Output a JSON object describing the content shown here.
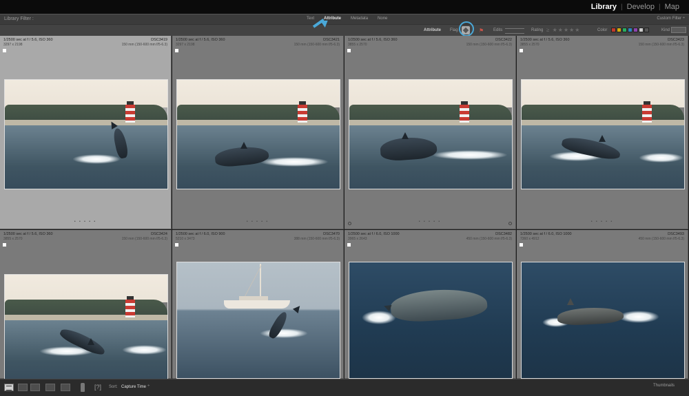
{
  "modules": {
    "library": "Library",
    "develop": "Develop",
    "map": "Map",
    "separator": "|"
  },
  "filter_bar": {
    "title": "Library Filter :",
    "tabs": [
      "Text",
      "Attribute",
      "Metadata",
      "None"
    ],
    "active_tab": "Attribute",
    "custom_filter": "Custom Filter ÷",
    "attribute_label": "Attribute",
    "flag_label": "Flag",
    "edits_label": "Edits",
    "rating_label": "Rating",
    "rating_stars": "≥ ★★★★★",
    "color_label": "Color",
    "kind_label": "Kind",
    "swatch_colors": [
      "#c0392b",
      "#d4ac0d",
      "#27ae60",
      "#2e86c1",
      "#8e44ad",
      "#cccccc",
      "#555555"
    ]
  },
  "grid": {
    "cells": [
      {
        "meta": "1/2500 sec at f / 5.6, ISO 360",
        "file": "DSC3419",
        "dims": "3297 x 2198",
        "lens": "150 mm (150-600 mm f/5-6.3)",
        "dots": "• • • • •"
      },
      {
        "meta": "1/2500 sec at f / 5.6, ISO 360",
        "file": "DSC3421",
        "dims": "3297 x 2198",
        "lens": "150 mm (150-600 mm f/5-6.3)",
        "dots": "• • • • •"
      },
      {
        "meta": "1/2500 sec at f / 5.6, ISO 360",
        "file": "DSC3422",
        "dims": "3855 x 2570",
        "lens": "150 mm (150-600 mm f/5-6.3)",
        "dots": "• • • • •"
      },
      {
        "meta": "1/2500 sec at f / 5.6, ISO 360",
        "file": "DSC3423",
        "dims": "3855 x 2570",
        "lens": "150 mm (150-600 mm f/5-6.3)",
        "dots": "• • • • •"
      },
      {
        "meta": "1/2500 sec at f / 5.6, ISO 360",
        "file": "DSC3424",
        "dims": "3855 x 2570",
        "lens": "150 mm (150-600 mm f/5-6.3)",
        "dots": ""
      },
      {
        "meta": "1/2500 sec at f / 6.0, ISO 900",
        "file": "DSC3470",
        "dims": "5210 x 3473",
        "lens": "388 mm (150-600 mm f/5-6.3)",
        "dots": ""
      },
      {
        "meta": "1/2500 sec at f / 6.0, ISO 1000",
        "file": "DSC3482",
        "dims": "3965 x 2643",
        "lens": "450 mm (150-600 mm f/5-6.3)",
        "dots": ""
      },
      {
        "meta": "1/2500 sec at f / 6.0, ISO 1000",
        "file": "DSC3493",
        "dims": "7360 x 4912",
        "lens": "450 mm (150-600 mm f/5-6.3)",
        "dots": ""
      }
    ]
  },
  "toolbar": {
    "sort_label": "Sort:",
    "sort_value": "Capture Time",
    "sort_chevron": "÷",
    "bracket": "[?]",
    "thumbnails_label": "Thumbnails"
  }
}
